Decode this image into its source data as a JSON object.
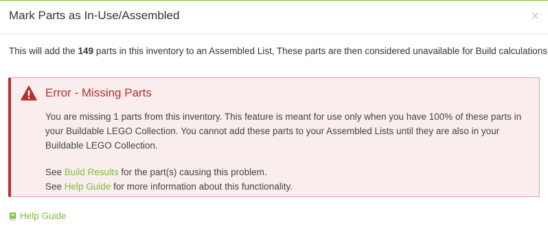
{
  "modal": {
    "title": "Mark Parts as In-Use/Assembled",
    "close_glyph": "×"
  },
  "intro": {
    "prefix": "This will add the ",
    "count": "149",
    "suffix": " parts in this inventory to an Assembled List, These parts are then considered unavailable for Build calculations."
  },
  "alert": {
    "icon": "warning-icon",
    "color": "#b5302e",
    "title": "Error - Missing Parts",
    "message": "You are missing 1 parts from this inventory. This feature is meant for use only when you have 100% of these parts in your Buildable LEGO Collection. You cannot add these parts to your Assembled Lists until they are also in your Buildable LEGO Collection.",
    "line1_prefix": "See ",
    "line1_link": "Build Results",
    "line1_suffix": " for the part(s) causing this problem.",
    "line2_prefix": "See ",
    "line2_link": "Help Guide",
    "line2_suffix": " for more information about this functionality."
  },
  "footer": {
    "icon": "book-icon",
    "help_label": "Help Guide",
    "link_color": "#7bbf3e"
  }
}
